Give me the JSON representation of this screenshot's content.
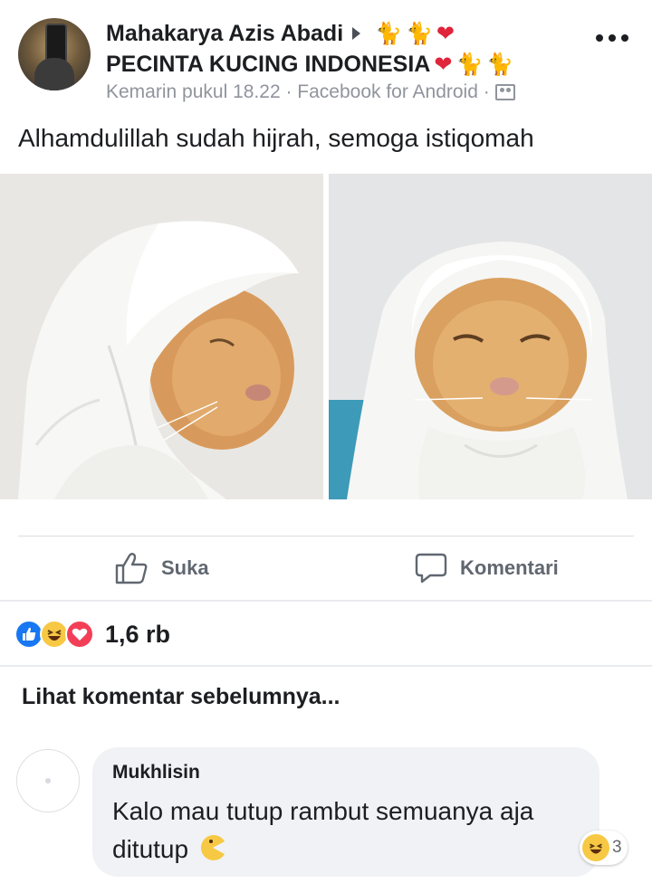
{
  "post": {
    "author": "Mahakarya Azis Abadi",
    "group": "PECINTA KUCING INDONESIA",
    "meta": "Kemarin pukul 18.22 · Facebook for Android ·",
    "text": "Alhamdulillah sudah hijrah, semoga istiqomah",
    "emojis_after_author": [
      "cat",
      "cat",
      "red-heart"
    ],
    "emojis_after_group": [
      "red-heart",
      "cat",
      "cat"
    ],
    "audience_icon": "group-members-icon",
    "photos": [
      {
        "label": "cat-in-white-hijab-side-view"
      },
      {
        "label": "cat-in-white-hijab-front-view"
      }
    ]
  },
  "actions": {
    "like_label": "Suka",
    "comment_label": "Komentari"
  },
  "reactions": {
    "types": [
      "like",
      "haha",
      "love"
    ],
    "count": "1,6 rb"
  },
  "comments": {
    "view_previous": "Lihat komentar sebelumnya...",
    "items": [
      {
        "author": "Mukhlisin",
        "text": "Kalo mau tutup rambut semuanya aja ditutup",
        "emoji": "pacman-face",
        "reaction": "haha",
        "reaction_count": "3"
      }
    ]
  },
  "colors": {
    "text": "#1c1e21",
    "secondary": "#90949c",
    "like_blue": "#1877f2",
    "love_red": "#f33e58",
    "haha_yellow": "#f7c844",
    "bubble": "#f0f2f5"
  }
}
